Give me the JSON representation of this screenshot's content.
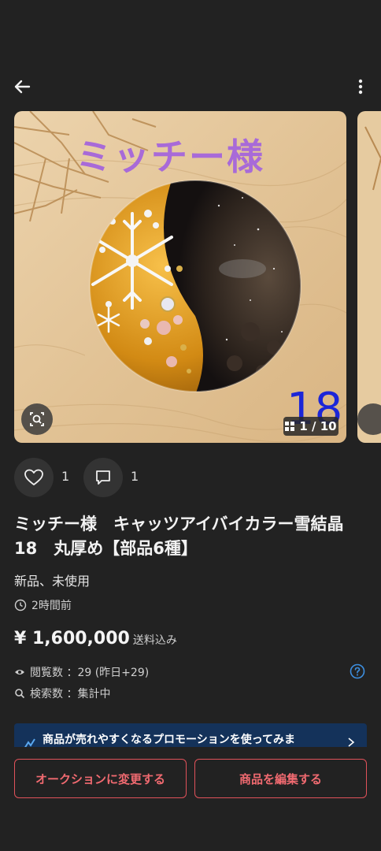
{
  "header": {
    "back_icon": "arrow-left-icon",
    "menu_icon": "more-vertical-icon"
  },
  "gallery": {
    "overlay_title": "ミッチー様",
    "overlay_number": "18",
    "counter": "1 / 10",
    "lens_icon": "image-search-icon",
    "grid_icon": "grid-icon"
  },
  "actions": {
    "like_count": "1",
    "comment_count": "1",
    "like_icon": "heart-icon",
    "comment_icon": "comment-icon"
  },
  "product": {
    "title": "ミッチー様　キャッツアイバイカラー雪結晶　18　丸厚め【部品6種】",
    "condition": "新品、未使用",
    "posted": "2時間前",
    "price": "¥ 1,600,000",
    "shipping": "送料込み",
    "views_label": "閲覧数 ：29 (昨日+29)",
    "search_label": "検索数 ：集計中"
  },
  "promo": {
    "text": "商品が売れやすくなるプロモーションを使ってみま"
  },
  "buttons": {
    "auction": "オークションに変更する",
    "edit": "商品を編集する"
  },
  "colors": {
    "background": "#222222",
    "accent": "#e0525a",
    "promo_bg": "#14325a",
    "help": "#3d8fe0"
  }
}
